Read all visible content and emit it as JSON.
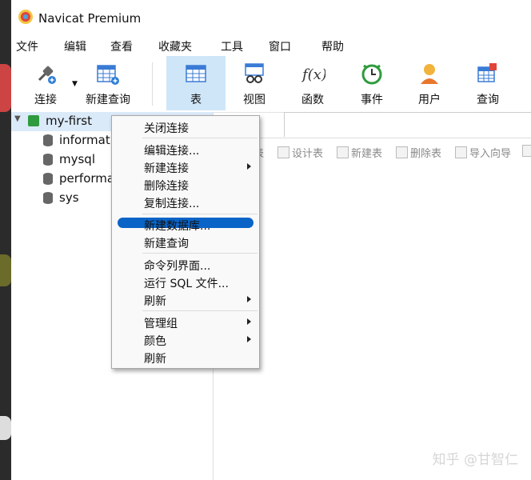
{
  "app": {
    "title": "Navicat Premium"
  },
  "menubar": [
    "文件",
    "编辑",
    "查看",
    "收藏夹",
    "工具",
    "窗口",
    "帮助"
  ],
  "toolbar": {
    "connect": "连接",
    "new_query": "新建查询",
    "table": "表",
    "view": "视图",
    "function": "函数",
    "event": "事件",
    "user": "用户",
    "query": "查询"
  },
  "tree": {
    "connection": "my-first",
    "databases": [
      "informati",
      "mysql",
      "performa",
      "sys"
    ]
  },
  "object_toolbar": [
    "表",
    "设计表",
    "新建表",
    "删除表",
    "导入向导",
    ""
  ],
  "context_menu": {
    "close_connection": "关闭连接",
    "edit_connection": "编辑连接...",
    "new_connection": "新建连接",
    "delete_connection": "删除连接",
    "copy_connection": "复制连接...",
    "new_database": "新建数据库...",
    "new_query": "新建查询",
    "command_console": "命令列界面...",
    "run_sql_file": "运行 SQL 文件...",
    "refresh": "刷新",
    "manage_group": "管理组",
    "color": "颜色",
    "refresh2": "刷新"
  },
  "watermark": "知乎 @甘智仁",
  "colors": {
    "accent": "#0a64c8",
    "toolbar_active": "#cfe6f8",
    "tree_selected": "#dbeaf8"
  }
}
